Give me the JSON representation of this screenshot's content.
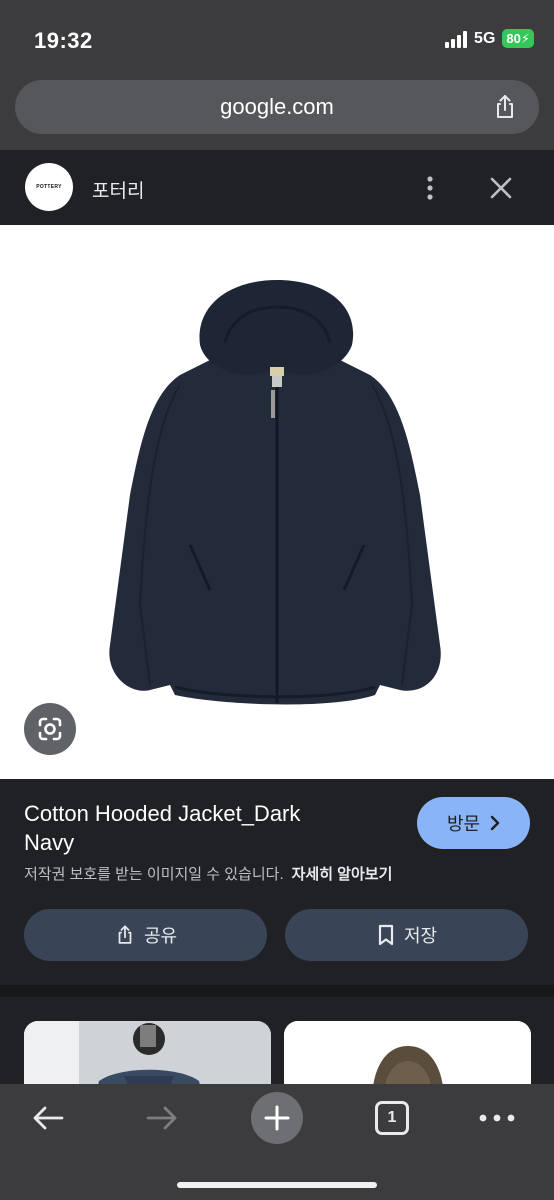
{
  "status": {
    "time": "19:32",
    "network": "5G",
    "battery": "80"
  },
  "browser": {
    "url": "google.com"
  },
  "site": {
    "logo_text": "POTTERY",
    "name": "포터리"
  },
  "product": {
    "title": "Cotton Hooded Jacket_Dark Navy",
    "visit_label": "방문",
    "copyright_notice": "저작권 보호를 받는 이미지일 수 있습니다.",
    "learn_more": "자세히 알아보기",
    "share_label": "공유",
    "save_label": "저장"
  },
  "toolbar": {
    "tab_count": "1"
  },
  "colors": {
    "accent": "#8ab4f8",
    "action_button": "#394457",
    "battery": "#34c759",
    "jacket": "#232b3b"
  },
  "icons": [
    "share-icon",
    "more-vert-icon",
    "close-icon",
    "lens-icon",
    "chevron-right-icon",
    "bookmark-icon",
    "back-arrow-icon",
    "forward-arrow-icon",
    "plus-icon",
    "more-horiz-icon"
  ]
}
